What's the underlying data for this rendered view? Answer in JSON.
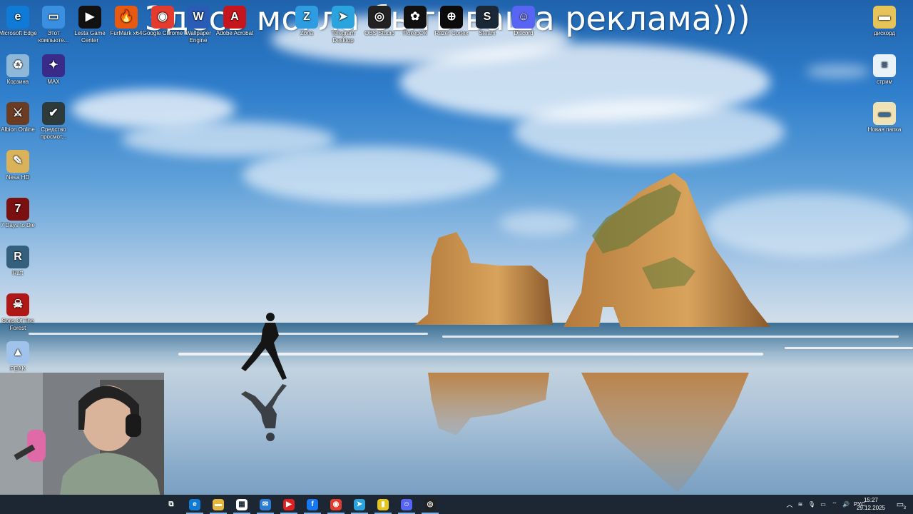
{
  "overlay": {
    "ad_text": "Здесь могла быть ваша реклама)))"
  },
  "desktop_icons": [
    {
      "id": "edge",
      "label": "Microsoft Edge",
      "icon": "edge-icon",
      "color": "#0f7bd6",
      "glyph": "e"
    },
    {
      "id": "this_pc",
      "label": "Этот компьюте...",
      "icon": "computer-icon",
      "color": "#3a8fe0",
      "glyph": "▭"
    },
    {
      "id": "lesta",
      "label": "Lesta Game Center",
      "icon": "lesta-icon",
      "color": "#111111",
      "glyph": "▶"
    },
    {
      "id": "furmark",
      "label": "FurMark x64",
      "icon": "furmark-icon",
      "color": "#e85a12",
      "glyph": "🔥"
    },
    {
      "id": "chrome",
      "label": "Google Chrome",
      "icon": "chrome-icon",
      "color": "#e33b2e",
      "glyph": "◉"
    },
    {
      "id": "wallpaper",
      "label": "Wallpaper Engine",
      "icon": "wallpaper-engine-icon",
      "color": "#2a5bb5",
      "glyph": "W"
    },
    {
      "id": "acrobat",
      "label": "Adobe Acrobat",
      "icon": "acrobat-icon",
      "color": "#c4161c",
      "glyph": "A"
    },
    {
      "id": "zona",
      "label": "Zona",
      "icon": "zona-icon",
      "color": "#2d9ce0",
      "glyph": "Z"
    },
    {
      "id": "telegram",
      "label": "Telegram Desktop",
      "icon": "telegram-icon",
      "color": "#2aa3de",
      "glyph": "➤"
    },
    {
      "id": "obs",
      "label": "OBS Studio",
      "icon": "obs-icon",
      "color": "#222222",
      "glyph": "◎"
    },
    {
      "id": "poker",
      "label": "ПокерОК",
      "icon": "pokerok-icon",
      "color": "#111111",
      "glyph": "✿"
    },
    {
      "id": "razer",
      "label": "Razer Cortex",
      "icon": "razer-icon",
      "color": "#0b0b0b",
      "glyph": "⊕"
    },
    {
      "id": "steam",
      "label": "Steam",
      "icon": "steam-icon",
      "color": "#1b2838",
      "glyph": "S"
    },
    {
      "id": "discord",
      "label": "Discord",
      "icon": "discord-icon",
      "color": "#5865f2",
      "glyph": "☺"
    },
    {
      "id": "trash",
      "label": "Корзина",
      "icon": "recycle-bin-icon",
      "color": "#8fb8d8",
      "glyph": "♻"
    },
    {
      "id": "max",
      "label": "MAX",
      "icon": "max-icon",
      "color": "#3a2a8a",
      "glyph": "✦"
    },
    {
      "id": "albion",
      "label": "Albion Online",
      "icon": "albion-icon",
      "color": "#6b3b22",
      "glyph": "⚔"
    },
    {
      "id": "viewer",
      "label": "Средство просмот...",
      "icon": "viewer-icon",
      "color": "#2f3a3a",
      "glyph": "✔"
    },
    {
      "id": "nesa",
      "label": "Nesa HD",
      "icon": "nesa-icon",
      "color": "#d9b25a",
      "glyph": "✎"
    },
    {
      "id": "7days",
      "label": "7 Days to Die",
      "icon": "7days-icon",
      "color": "#7a1010",
      "glyph": "7"
    },
    {
      "id": "raft",
      "label": "Raft",
      "icon": "raft-icon",
      "color": "#34607e",
      "glyph": "R"
    },
    {
      "id": "sotf",
      "label": "Sons Of The Forest",
      "icon": "sons-forest-icon",
      "color": "#b01818",
      "glyph": "☠"
    },
    {
      "id": "peak",
      "label": "PEAK",
      "icon": "peak-icon",
      "color": "#9fc3ea",
      "glyph": "▲"
    },
    {
      "id": "diskord",
      "label": "дискорд",
      "icon": "folder-icon",
      "color": "#e6c45a",
      "glyph": "▬"
    },
    {
      "id": "strim",
      "label": "стрим",
      "icon": "text-file-icon",
      "color": "#e9f2f7",
      "glyph": "≡"
    },
    {
      "id": "new_folder",
      "label": "Новая папка",
      "icon": "folder-icon",
      "color": "#efe3b6",
      "glyph": "▬"
    }
  ],
  "taskbar": {
    "buttons": [
      {
        "id": "task_view",
        "icon": "task-view-icon",
        "color": "#1c2733",
        "glyph": "⧉"
      },
      {
        "id": "edge",
        "icon": "edge-icon",
        "color": "#0f7bd6",
        "glyph": "e"
      },
      {
        "id": "explorer",
        "icon": "file-explorer-icon",
        "color": "#e7b73c",
        "glyph": "▬"
      },
      {
        "id": "store",
        "icon": "store-icon",
        "color": "#ffffff",
        "glyph": "▦"
      },
      {
        "id": "mail",
        "icon": "mail-icon",
        "color": "#2b7cd3",
        "glyph": "✉"
      },
      {
        "id": "youtube",
        "icon": "youtube-icon",
        "color": "#e02020",
        "glyph": "▶"
      },
      {
        "id": "facebook",
        "icon": "facebook-icon",
        "color": "#1877f2",
        "glyph": "f"
      },
      {
        "id": "chrome",
        "icon": "chrome-icon",
        "color": "#e33b2e",
        "glyph": "◉"
      },
      {
        "id": "telegram",
        "icon": "telegram-icon",
        "color": "#2aa3de",
        "glyph": "➤"
      },
      {
        "id": "lesta",
        "icon": "lesta-icon",
        "color": "#e8c51a",
        "glyph": "▮"
      },
      {
        "id": "discord",
        "icon": "discord-icon",
        "color": "#5865f2",
        "glyph": "☺"
      },
      {
        "id": "obs",
        "icon": "obs-icon",
        "color": "#222222",
        "glyph": "◎"
      }
    ],
    "tray": {
      "chevron_icon": "chevron-up-icon",
      "language": "РУС",
      "time": "15:27",
      "date": "29.12.2025",
      "notifications_count": "3"
    }
  }
}
